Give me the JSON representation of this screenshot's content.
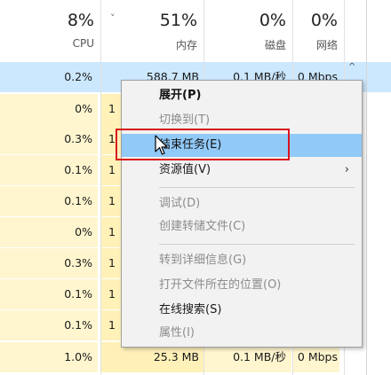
{
  "header": {
    "cpu": {
      "pct": "8%",
      "label": "CPU"
    },
    "mem": {
      "pct": "51%",
      "label": "内存",
      "sort_glyph": "˅"
    },
    "disk": {
      "pct": "0%",
      "label": "磁盘"
    },
    "net": {
      "pct": "0%",
      "label": "网络"
    }
  },
  "rows": [
    {
      "cpu": "0.2%",
      "mem": "588.7 MB",
      "disk": "0.1 MB/秒",
      "net": "0 Mbps"
    },
    {
      "cpu": "0%",
      "mem": "1",
      "disk": "",
      "net": ""
    },
    {
      "cpu": "0.3%",
      "mem": "1",
      "disk": "",
      "net": ""
    },
    {
      "cpu": "0.1%",
      "mem": "1",
      "disk": "",
      "net": ""
    },
    {
      "cpu": "0.1%",
      "mem": "1",
      "disk": "",
      "net": ""
    },
    {
      "cpu": "0%",
      "mem": "1",
      "disk": "",
      "net": ""
    },
    {
      "cpu": "0.3%",
      "mem": "1",
      "disk": "",
      "net": ""
    },
    {
      "cpu": "0.1%",
      "mem": "1",
      "disk": "",
      "net": ""
    },
    {
      "cpu": "0.1%",
      "mem": "1",
      "disk": "",
      "net": ""
    },
    {
      "cpu": "1.0%",
      "mem": "25.3 MB",
      "disk": "0.1 MB/秒",
      "net": "0 Mbps"
    }
  ],
  "scroll_caret": "^",
  "menu": {
    "expand": "展开(P)",
    "switch_to": "切换到(T)",
    "end_task": "结束任务(E)",
    "resource_values": "资源值(V)",
    "submenu_arrow": "›",
    "debug": "调试(D)",
    "create_dump": "创建转储文件(C)",
    "goto_details": "转到详细信息(G)",
    "open_location": "打开文件所在的位置(O)",
    "search_online": "在线搜索(S)",
    "properties": "属性(I)"
  },
  "colors": {
    "selected_row": "#cce8ff",
    "cpu_heat": "#fff4c4",
    "mem_heat": "#fff0b3",
    "highlight": "#91c9f7",
    "callout": "#d8141c"
  }
}
